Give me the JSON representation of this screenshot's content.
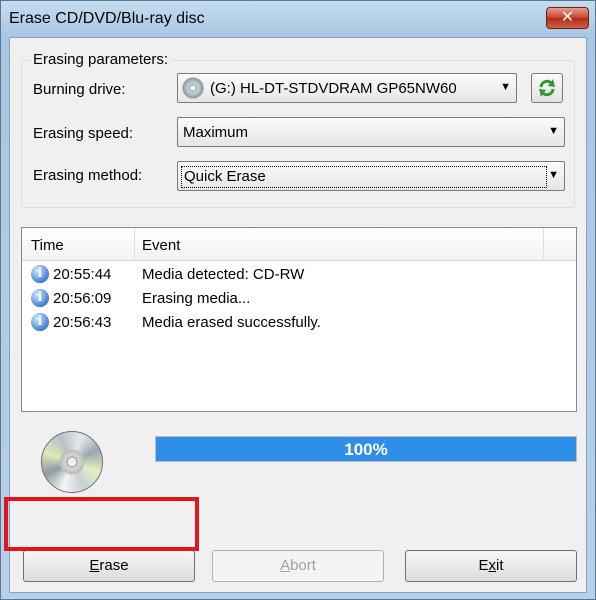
{
  "window": {
    "title": "Erase CD/DVD/Blu-ray disc",
    "close_glyph": "✕"
  },
  "params": {
    "group_title": "Erasing parameters:",
    "drive_label": "Burning drive:",
    "drive_value": "(G:) HL-DT-STDVDRAM GP65NW60",
    "speed_label": "Erasing speed:",
    "speed_value": "Maximum",
    "method_label": "Erasing method:",
    "method_value": "Quick Erase",
    "refresh_icon": "refresh-icon"
  },
  "log": {
    "columns": [
      "Time",
      "Event"
    ],
    "rows": [
      {
        "time": "20:55:44",
        "event": "Media detected: CD-RW"
      },
      {
        "time": "20:56:09",
        "event": "Erasing media..."
      },
      {
        "time": "20:56:43",
        "event": "Media erased successfully."
      }
    ]
  },
  "progress": {
    "value": 1.0,
    "label": "100%"
  },
  "buttons": {
    "erase_mnemonic": "E",
    "erase_rest": "rase",
    "abort_mnemonic": "A",
    "abort_rest": "bort",
    "exit_first": "E",
    "exit_mnemonic": "x",
    "exit_rest": "it"
  },
  "colors": {
    "highlight": "#e0161c",
    "progress": "#2f8fe8"
  }
}
